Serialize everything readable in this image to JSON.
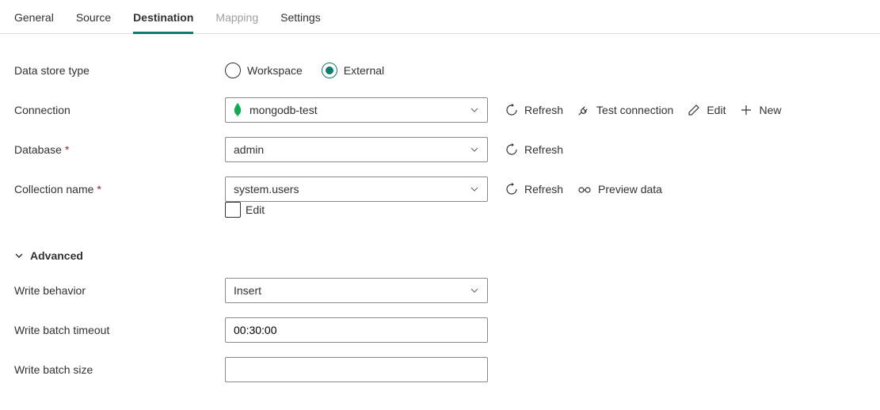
{
  "tabs": {
    "items": [
      {
        "label": "General",
        "state": "normal"
      },
      {
        "label": "Source",
        "state": "normal"
      },
      {
        "label": "Destination",
        "state": "active"
      },
      {
        "label": "Mapping",
        "state": "disabled"
      },
      {
        "label": "Settings",
        "state": "normal"
      }
    ]
  },
  "labels": {
    "data_store_type": "Data store type",
    "connection": "Connection",
    "database": "Database",
    "collection_name": "Collection name",
    "edit_checkbox": "Edit",
    "advanced": "Advanced",
    "write_behavior": "Write behavior",
    "write_batch_timeout": "Write batch timeout",
    "write_batch_size": "Write batch size"
  },
  "data_store_type": {
    "options": [
      {
        "label": "Workspace",
        "selected": false
      },
      {
        "label": "External",
        "selected": true
      }
    ]
  },
  "connection": {
    "value": "mongodb-test",
    "actions": {
      "refresh": "Refresh",
      "test": "Test connection",
      "edit": "Edit",
      "new": "New"
    }
  },
  "database": {
    "value": "admin",
    "actions": {
      "refresh": "Refresh"
    }
  },
  "collection": {
    "value": "system.users",
    "actions": {
      "refresh": "Refresh",
      "preview": "Preview data"
    },
    "edit_checked": false
  },
  "advanced": {
    "expanded": true,
    "write_behavior": {
      "value": "Insert"
    },
    "write_batch_timeout": {
      "value": "00:30:00"
    },
    "write_batch_size": {
      "value": ""
    }
  }
}
